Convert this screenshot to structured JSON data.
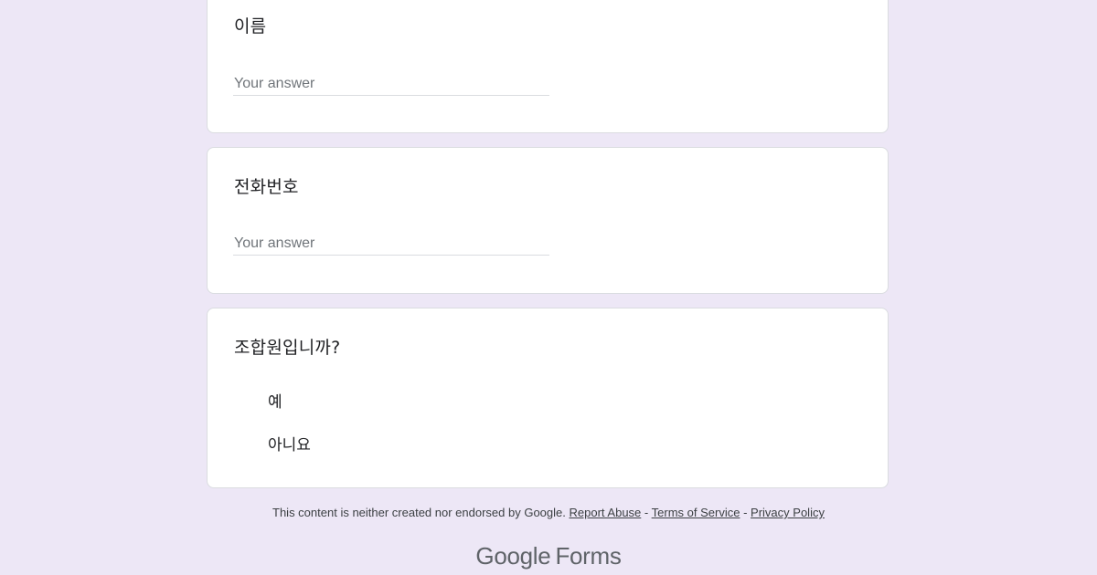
{
  "questions": [
    {
      "title": "이름",
      "placeholder": "Your answer"
    },
    {
      "title": "전화번호",
      "placeholder": "Your answer"
    },
    {
      "title": "조합원입니까?",
      "options": [
        "예",
        "아니요"
      ]
    }
  ],
  "footer": {
    "disclaimer": "This content is neither created nor endorsed by Google.",
    "report_abuse": "Report Abuse",
    "separator": "-",
    "terms": "Terms of Service",
    "privacy": "Privacy Policy"
  },
  "logo": {
    "brand": "Google",
    "product": "Forms"
  },
  "colors": {
    "background": "#ede7f6",
    "card": "#ffffff"
  }
}
